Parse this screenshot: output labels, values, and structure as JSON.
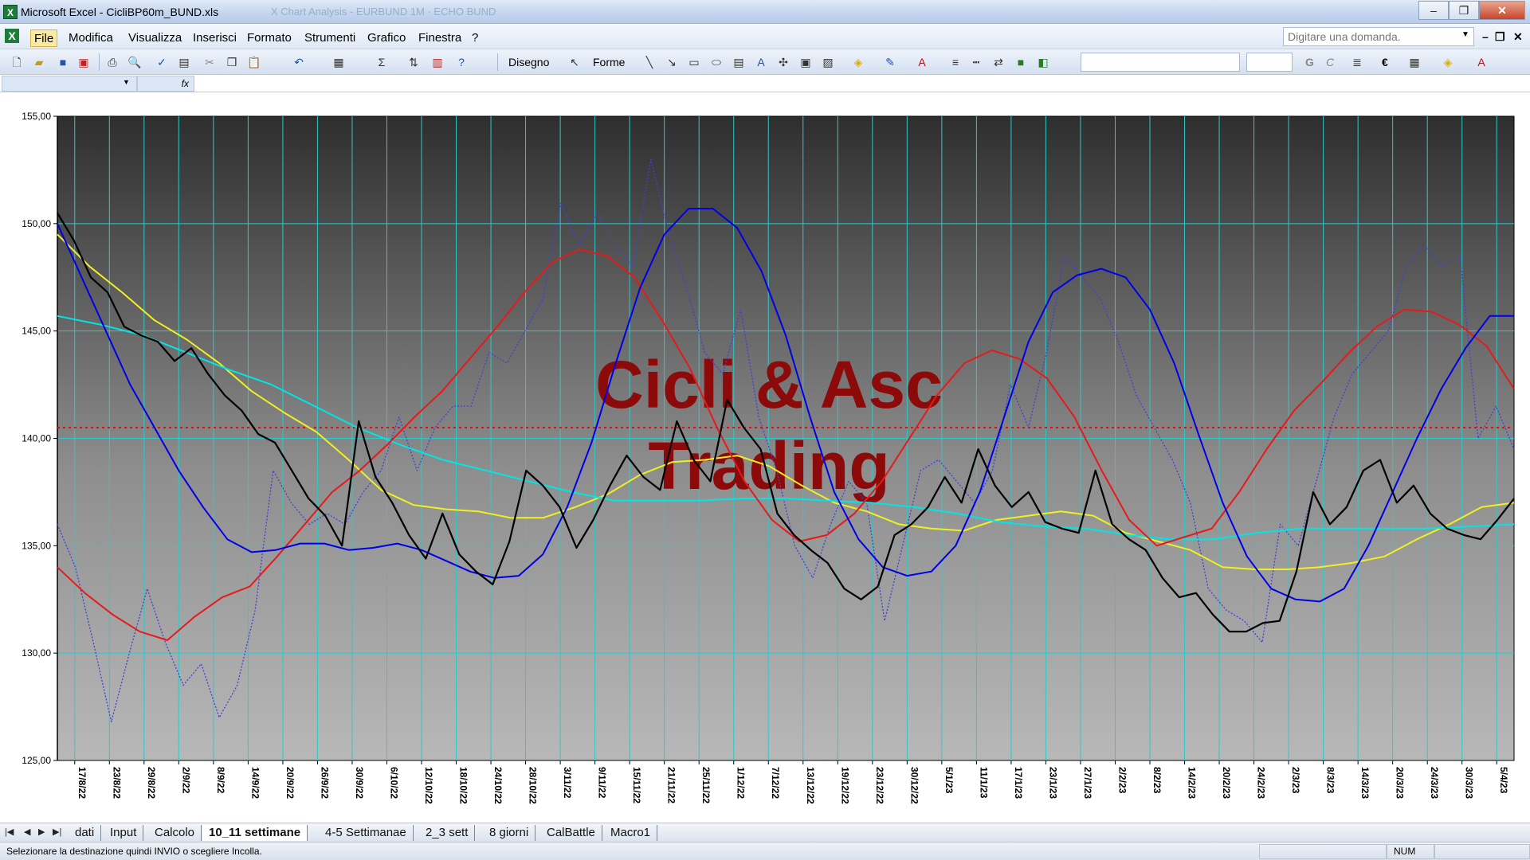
{
  "window": {
    "title": "Microsoft Excel - CicliBP60m_BUND.xls",
    "faded_tabs": "X Chart Analysis - EURBUND 1M  ·  ECHO BUND",
    "minimize": "–",
    "maximize": "❐",
    "close": "✕"
  },
  "menu": {
    "items": [
      "File",
      "Modifica",
      "Visualizza",
      "Inserisci",
      "Formato",
      "Strumenti",
      "Grafico",
      "Finestra",
      "?"
    ],
    "ask_placeholder": "Digitare una domanda.",
    "mdi_min": "–",
    "mdi_restore": "❐",
    "mdi_close": "✕"
  },
  "toolbar": {
    "disegno": "Disegno",
    "forme": "Forme",
    "bold": "G",
    "italic": "C",
    "euro": "€",
    "fx": "fx"
  },
  "chart_data": {
    "type": "line",
    "watermark": [
      "Cicli & Asc",
      "Trading"
    ],
    "ylim": [
      125,
      155
    ],
    "y_ticks": [
      "125,00",
      "130,00",
      "135,00",
      "140,00",
      "145,00",
      "150,00",
      "155,00"
    ],
    "x_labels": [
      "17/8/22",
      "23/8/22",
      "29/8/22",
      "2/9/22",
      "8/9/22",
      "14/9/22",
      "20/9/22",
      "26/9/22",
      "30/9/22",
      "6/10/22",
      "12/10/22",
      "18/10/22",
      "24/10/22",
      "28/10/22",
      "3/11/22",
      "9/11/22",
      "15/11/22",
      "21/11/22",
      "25/11/22",
      "1/12/22",
      "7/12/22",
      "13/12/22",
      "19/12/22",
      "23/12/22",
      "30/12/22",
      "5/1/23",
      "11/1/23",
      "17/1/23",
      "23/1/23",
      "27/1/23",
      "2/2/23",
      "8/2/23",
      "14/2/23",
      "20/2/23",
      "24/2/23",
      "2/3/23",
      "8/3/23",
      "14/3/23",
      "20/3/23",
      "24/3/23",
      "30/3/23",
      "5/4/23"
    ],
    "reference_line": 140.5,
    "series": [
      {
        "color": "#000000",
        "style": "solid",
        "width": 2.2,
        "values": [
          150.5,
          149.2,
          147.5,
          146.8,
          145.2,
          144.8,
          144.5,
          143.6,
          144.2,
          143.0,
          142.0,
          141.3,
          140.2,
          139.8,
          138.5,
          137.2,
          136.4,
          135.0,
          140.8,
          138.2,
          137.0,
          135.5,
          134.4,
          136.5,
          134.6,
          133.8,
          133.2,
          135.2,
          138.5,
          137.8,
          136.8,
          134.9,
          136.2,
          137.8,
          139.2,
          138.2,
          137.6,
          140.8,
          139.0,
          138.0,
          141.8,
          140.5,
          139.5,
          136.5,
          135.5,
          134.8,
          134.2,
          133.0,
          132.5,
          133.1,
          135.5,
          136.0,
          136.8,
          138.2,
          137.0,
          139.5,
          137.8,
          136.8,
          137.5,
          136.1,
          135.8,
          135.6,
          138.5,
          136.0,
          135.3,
          134.8,
          133.5,
          132.6,
          132.8,
          131.8,
          131.0,
          131.0,
          131.4,
          131.5,
          133.8,
          137.5,
          136.0,
          136.8,
          138.5,
          139.0,
          137.0,
          137.8,
          136.5,
          135.8,
          135.5,
          135.3,
          136.2,
          137.2
        ]
      },
      {
        "color": "#4040d8",
        "style": "dotted",
        "width": 1.3,
        "values": [
          136.0,
          134.0,
          130.5,
          126.8,
          130.0,
          133.0,
          130.5,
          128.5,
          129.5,
          127.0,
          128.5,
          132.0,
          138.5,
          137.0,
          136.0,
          136.5,
          136.0,
          137.5,
          138.5,
          141.0,
          138.5,
          140.5,
          141.5,
          141.5,
          144.0,
          143.5,
          145.0,
          146.5,
          151.0,
          149.0,
          150.5,
          149.0,
          148.0,
          153.0,
          149.5,
          147.0,
          144.0,
          143.0,
          146.0,
          141.0,
          138.5,
          135.0,
          133.5,
          136.0,
          138.0,
          137.0,
          131.5,
          135.0,
          138.5,
          139.0,
          138.0,
          137.0,
          138.5,
          142.5,
          140.5,
          144.0,
          148.5,
          147.5,
          146.5,
          144.5,
          142.0,
          140.5,
          139.0,
          137.0,
          133.0,
          132.0,
          131.5,
          130.5,
          136.0,
          135.0,
          138.0,
          141.0,
          143.0,
          144.0,
          145.0,
          148.0,
          149.0,
          148.0,
          148.5,
          140.0,
          141.5,
          139.5
        ]
      },
      {
        "color": "#0000e6",
        "style": "solid",
        "width": 2,
        "values": [
          150.0,
          147.5,
          145.0,
          142.5,
          140.5,
          138.5,
          136.8,
          135.3,
          134.7,
          134.8,
          135.1,
          135.1,
          134.8,
          134.9,
          135.1,
          134.8,
          134.3,
          133.8,
          133.5,
          133.6,
          134.6,
          136.8,
          139.8,
          143.5,
          147.0,
          149.5,
          150.7,
          150.7,
          149.8,
          147.8,
          144.8,
          141.0,
          137.5,
          135.3,
          134.0,
          133.6,
          133.8,
          135.0,
          137.5,
          141.0,
          144.5,
          146.8,
          147.6,
          147.9,
          147.5,
          146.0,
          143.5,
          140.2,
          137.0,
          134.5,
          133.0,
          132.5,
          132.4,
          133.0,
          135.0,
          137.5,
          140.0,
          142.3,
          144.2,
          145.7,
          145.7
        ]
      },
      {
        "color": "#e61a1a",
        "style": "solid",
        "width": 2,
        "values": [
          134.0,
          132.8,
          131.8,
          131.0,
          130.6,
          131.7,
          132.6,
          133.1,
          134.5,
          136.0,
          137.5,
          138.5,
          139.7,
          141.0,
          142.2,
          143.7,
          145.2,
          146.8,
          148.2,
          148.8,
          148.5,
          147.5,
          145.5,
          143.3,
          140.5,
          138.0,
          136.2,
          135.2,
          135.5,
          136.5,
          138.0,
          140.0,
          142.0,
          143.5,
          144.1,
          143.7,
          142.8,
          141.0,
          138.5,
          136.2,
          135.0,
          135.4,
          135.8,
          137.5,
          139.5,
          141.3,
          142.6,
          144.0,
          145.2,
          146.0,
          145.9,
          145.3,
          144.3,
          142.3
        ]
      },
      {
        "color": "#f0f020",
        "style": "solid",
        "width": 2,
        "values": [
          149.5,
          148.0,
          146.8,
          145.5,
          144.6,
          143.5,
          142.2,
          141.2,
          140.3,
          139.0,
          137.6,
          136.9,
          136.7,
          136.6,
          136.3,
          136.3,
          136.8,
          137.4,
          138.3,
          138.9,
          139.0,
          139.2,
          138.7,
          137.8,
          137.0,
          136.6,
          136.0,
          135.8,
          135.7,
          136.2,
          136.4,
          136.6,
          136.4,
          135.6,
          135.2,
          134.8,
          134.0,
          133.9,
          133.9,
          134.0,
          134.2,
          134.5,
          135.3,
          136.0,
          136.8,
          137.0
        ]
      },
      {
        "color": "#00e6e6",
        "style": "solid",
        "width": 2,
        "values": [
          145.7,
          145.3,
          144.8,
          144.0,
          143.2,
          142.5,
          141.5,
          140.5,
          139.7,
          139.0,
          138.5,
          138.0,
          137.5,
          137.1,
          137.1,
          137.1,
          137.2,
          137.2,
          137.1,
          137.0,
          136.8,
          136.5,
          136.1,
          135.9,
          135.8,
          135.5,
          135.3,
          135.3,
          135.6,
          135.8,
          135.8,
          135.8,
          135.8,
          135.9,
          136.0
        ]
      }
    ]
  },
  "sheet_tabs": [
    "dati",
    "Input",
    "Calcolo",
    "10_11 settimane",
    "4-5 Settimanae",
    "2_3 sett",
    "8 giorni",
    "CalBattle",
    "Macro1"
  ],
  "active_tab": "10_11 settimane",
  "status": {
    "message": "Selezionare la destinazione quindi INVIO o scegliere Incolla.",
    "num": "NUM"
  }
}
